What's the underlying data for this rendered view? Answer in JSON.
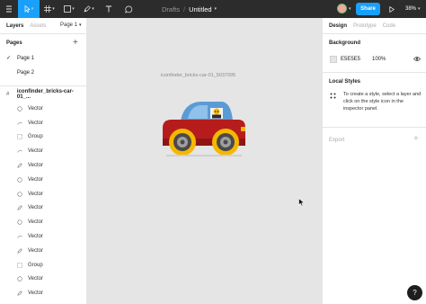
{
  "toolbar": {
    "breadcrumb": "Drafts",
    "separator": "/",
    "file_name": "Untitled",
    "share_label": "Share",
    "zoom_label": "38%"
  },
  "left_panel": {
    "tabs": [
      "Layers",
      "Assets"
    ],
    "page_selector": "Page 1",
    "pages_header": "Pages",
    "pages": [
      {
        "label": "Page 1",
        "selected": true
      },
      {
        "label": "Page 2",
        "selected": false
      }
    ],
    "frame_name": "iconfinder_bricks-car-01_...",
    "layers": [
      {
        "label": "Vector",
        "icon": "circle-vector-icon"
      },
      {
        "label": "Vector",
        "icon": "line-vector-icon"
      },
      {
        "label": "Group",
        "icon": "group-icon"
      },
      {
        "label": "Vector",
        "icon": "line-vector-icon"
      },
      {
        "label": "Vector",
        "icon": "pen-vector-icon"
      },
      {
        "label": "Vector",
        "icon": "circle-vector-icon"
      },
      {
        "label": "Vector",
        "icon": "circle-vector-icon"
      },
      {
        "label": "Vector",
        "icon": "pen-vector-icon"
      },
      {
        "label": "Vector",
        "icon": "circle-vector-icon"
      },
      {
        "label": "Vector",
        "icon": "line-vector-icon"
      },
      {
        "label": "Vector",
        "icon": "pen-vector-icon"
      },
      {
        "label": "Group",
        "icon": "group-icon"
      },
      {
        "label": "Vector",
        "icon": "circle-vector-icon"
      },
      {
        "label": "Vector",
        "icon": "pen-vector-icon"
      }
    ]
  },
  "canvas": {
    "frame_label": "iconfinder_bricks-car-01_5037095"
  },
  "right_panel": {
    "tabs": [
      "Design",
      "Prototype",
      "Code"
    ],
    "background_title": "Background",
    "background_hex": "E5E5E5",
    "background_opacity": "100%",
    "local_styles_title": "Local Styles",
    "local_styles_text": "To create a style, select a layer and click on the style icon in the inspector panel.",
    "export_title": "Export"
  },
  "help_label": "?",
  "colors": {
    "toolbar_bg": "#2c2c2c",
    "accent": "#18a0fb",
    "canvas_bg": "#e5e5e5",
    "car_body": "#b71c1c",
    "car_roof": "#5b9bd5",
    "wheel_rim": "#f5b800"
  }
}
